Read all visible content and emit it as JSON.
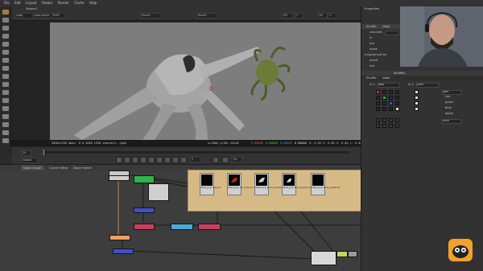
{
  "menubar": {
    "items": [
      "File",
      "Edit",
      "Layout",
      "Viewer",
      "Render",
      "Cache",
      "Help"
    ]
  },
  "viewer": {
    "tab": "Viewer1",
    "controls": {
      "channels": "rgba",
      "mode": "rgba.alpha",
      "display": "RGB",
      "input_a": "Read1",
      "input_b": "Read1",
      "gain": "f/8",
      "gamma": "1",
      "frame": "1",
      "proxy": "2D"
    },
    "info_left": "2048x1536 bbox: 0 0 2048 1536 channels: rgba",
    "info_coords": "x=1368 y=764",
    "info_zoom": "25x18",
    "info_vals": [
      "0.00000",
      "0.00000",
      "0.00000",
      "0.00000"
    ],
    "info_extra": "H: 0.00 S: 0.00 V: 0.00 L: 0.00000"
  },
  "timeline": {
    "fps": "24",
    "frame": "1",
    "range_label": "Global",
    "ticks": [
      "1",
      "10",
      "20",
      "30",
      "40",
      "50",
      "60",
      "70",
      "80",
      "90",
      "100"
    ]
  },
  "node_graph": {
    "tabs": [
      "Node Graph",
      "Curve Editor",
      "Dope Sheet"
    ],
    "backdrop_thumbs": [
      "head_pos_orig.exr",
      "head_pos_ref_noise.exr",
      "head_pos_prime_grade.exr",
      "head_pos_final_grade.exr",
      "head_pos_final_grade.exr"
    ]
  },
  "properties": {
    "title": "Properties",
    "node_tabs": [
      "Shuffle",
      "Node"
    ],
    "panel1_labels": [
      "channels",
      "in",
      "out",
      "mask",
      "(un)premult by",
      "invert",
      "mix"
    ],
    "panel1_value": "rgba",
    "shuffle_title": "Shuffle1",
    "shuffle_in_labels": [
      "in 1",
      "in 2"
    ],
    "shuffle_in_values": [
      "rgba",
      "none"
    ],
    "shuffle_out_labels": [
      "red",
      "green",
      "blue",
      "alpha"
    ],
    "shuffle_out_value": "rgba",
    "shuffle_out2_value": "none"
  },
  "colors": {
    "bg": "#2b2b2b",
    "viewport_gray": "#7d7d7d",
    "backdrop": "#d6ba86",
    "accent_orange": "#f08c28"
  }
}
